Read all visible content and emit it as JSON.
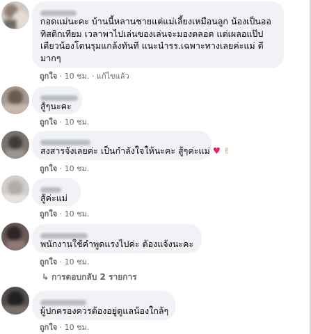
{
  "comments": [
    {
      "text_lines": [
        "กอดแม่นะคะ บ้านนี้หลานชายแต่แม่เลี้ยงเหมือนลูก น้องเป็นออ",
        "ทิสติกเทียม เวลาพาไปเล่นของเล่นจะมองตลอด แต่เผลอแป๊ป",
        "เดียวน้องโดนรุมแกล้งทันที แนะนำรร.เฉพาะทางเลยค่ะแม่ ดี",
        "มากๆ"
      ],
      "like_label": "ถูกใจ",
      "time": "10 ชม.",
      "edited_label": "แก้ไขแล้ว"
    },
    {
      "text_lines": [
        "สู้ๆนะคะ"
      ],
      "like_label": "ถูกใจ",
      "time": "10 ชม."
    },
    {
      "text_lines": [
        "สงสารจังเลยค่ะ เป็นกำลังใจให้นะคะ สู้ๆค่ะแม่"
      ],
      "emojis": [
        "♥",
        "✌"
      ],
      "like_label": "ถูกใจ",
      "time": "10 ชม."
    },
    {
      "text_lines": [
        "สู้ค่ะแม่"
      ],
      "like_label": "ถูกใจ",
      "time": "10 ชม."
    },
    {
      "text_lines": [
        "พนักงานใช้คำพูดแรงไปค่ะ ต้องแจ้งนะคะ"
      ],
      "like_label": "ถูกใจ",
      "time": "10 ชม.",
      "replies_label": "การตอบกลับ 2 รายการ"
    },
    {
      "text_lines": [
        "ผู้ปกครองควรต้องอยู่ดูแลน้องใกล้ๆ"
      ],
      "like_label": "ถูกใจ",
      "time": "10 ชม."
    }
  ],
  "separator": "·",
  "reply_arrow": "↳",
  "colors": {
    "bubble": "#f0f2f5",
    "meta_text": "#65676b",
    "body_text": "#050505"
  }
}
